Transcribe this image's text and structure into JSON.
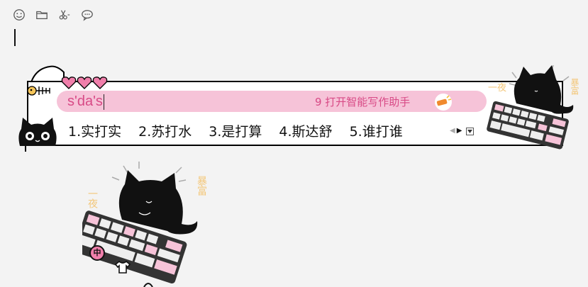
{
  "toolbar": {
    "icons": [
      "emoji-icon",
      "folder-icon",
      "scissors-icon",
      "chat-bubble-icon"
    ]
  },
  "ime": {
    "composition": "s'da's",
    "assistant_label": "9  打开智能写作助手",
    "candidates": [
      "1.实打实",
      "2.苏打水",
      "3.是打算",
      "4.斯达舒",
      "5.谁打谁"
    ],
    "theme": {
      "pink": "#f6c3d8",
      "text_pink": "#d84a86",
      "frame": "#000000"
    }
  },
  "decor": {
    "sticker_text_left": "一夜",
    "sticker_text_right": "暴富",
    "ime_badge": "中"
  }
}
